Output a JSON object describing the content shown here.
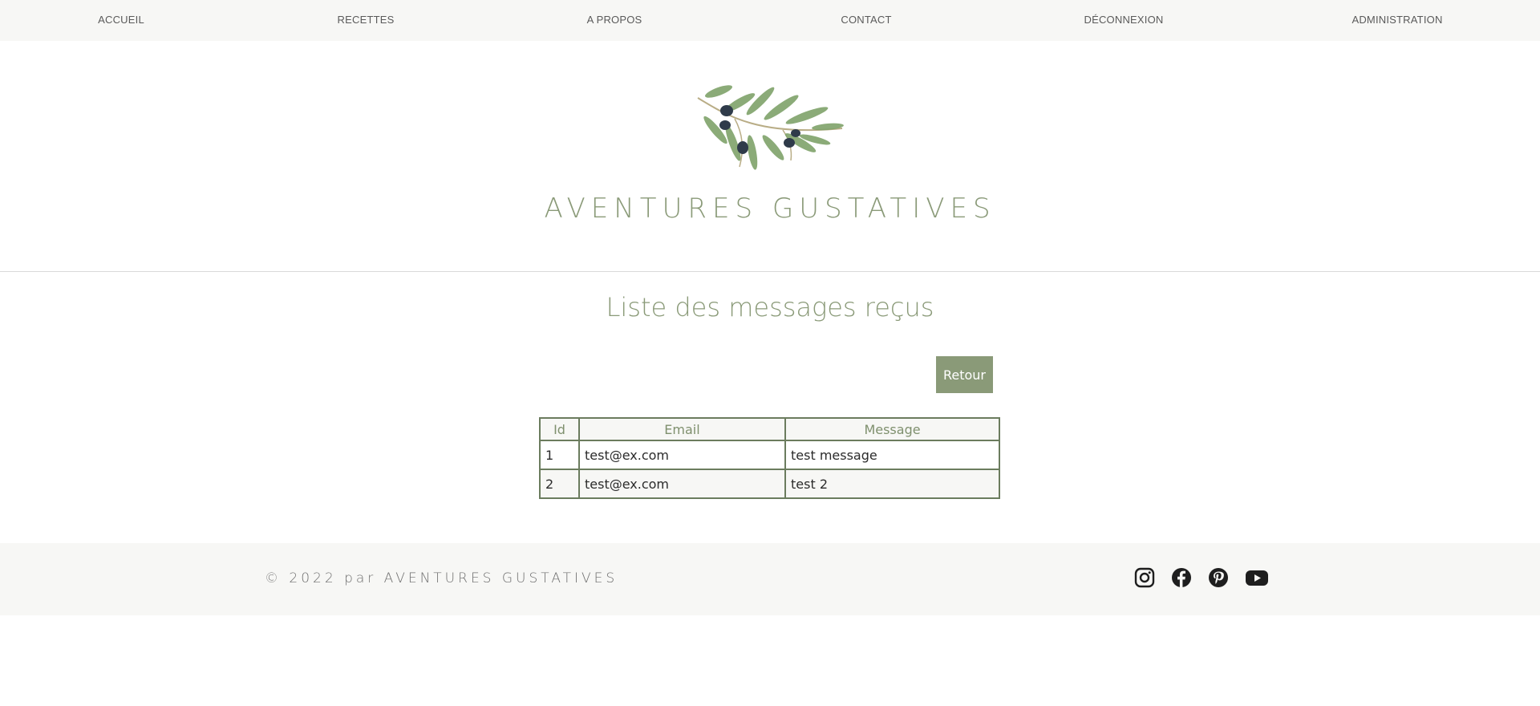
{
  "nav": {
    "items": [
      {
        "label": "ACCUEIL"
      },
      {
        "label": "RECETTES"
      },
      {
        "label": "A PROPOS"
      },
      {
        "label": "CONTACT"
      },
      {
        "label": "DÉCONNEXION"
      },
      {
        "label": "ADMINISTRATION"
      }
    ]
  },
  "header": {
    "logo_icon": "olive-branch-icon",
    "brand": "AVENTURES GUSTATIVES"
  },
  "main": {
    "title": "Liste des messages reçus",
    "back_label": "Retour",
    "table": {
      "headers": [
        "Id",
        "Email",
        "Message"
      ],
      "rows": [
        [
          "1",
          "test@ex.com",
          "test message"
        ],
        [
          "2",
          "test@ex.com",
          "test 2"
        ]
      ]
    }
  },
  "footer": {
    "copyright": "© 2022 par AVENTURES GUSTATIVES",
    "socials": [
      "instagram-icon",
      "facebook-icon",
      "pinterest-icon",
      "youtube-icon"
    ]
  },
  "colors": {
    "accent": "#8a9a78",
    "table_border": "#6b7c5e",
    "nav_bg": "#f7f7f5"
  }
}
